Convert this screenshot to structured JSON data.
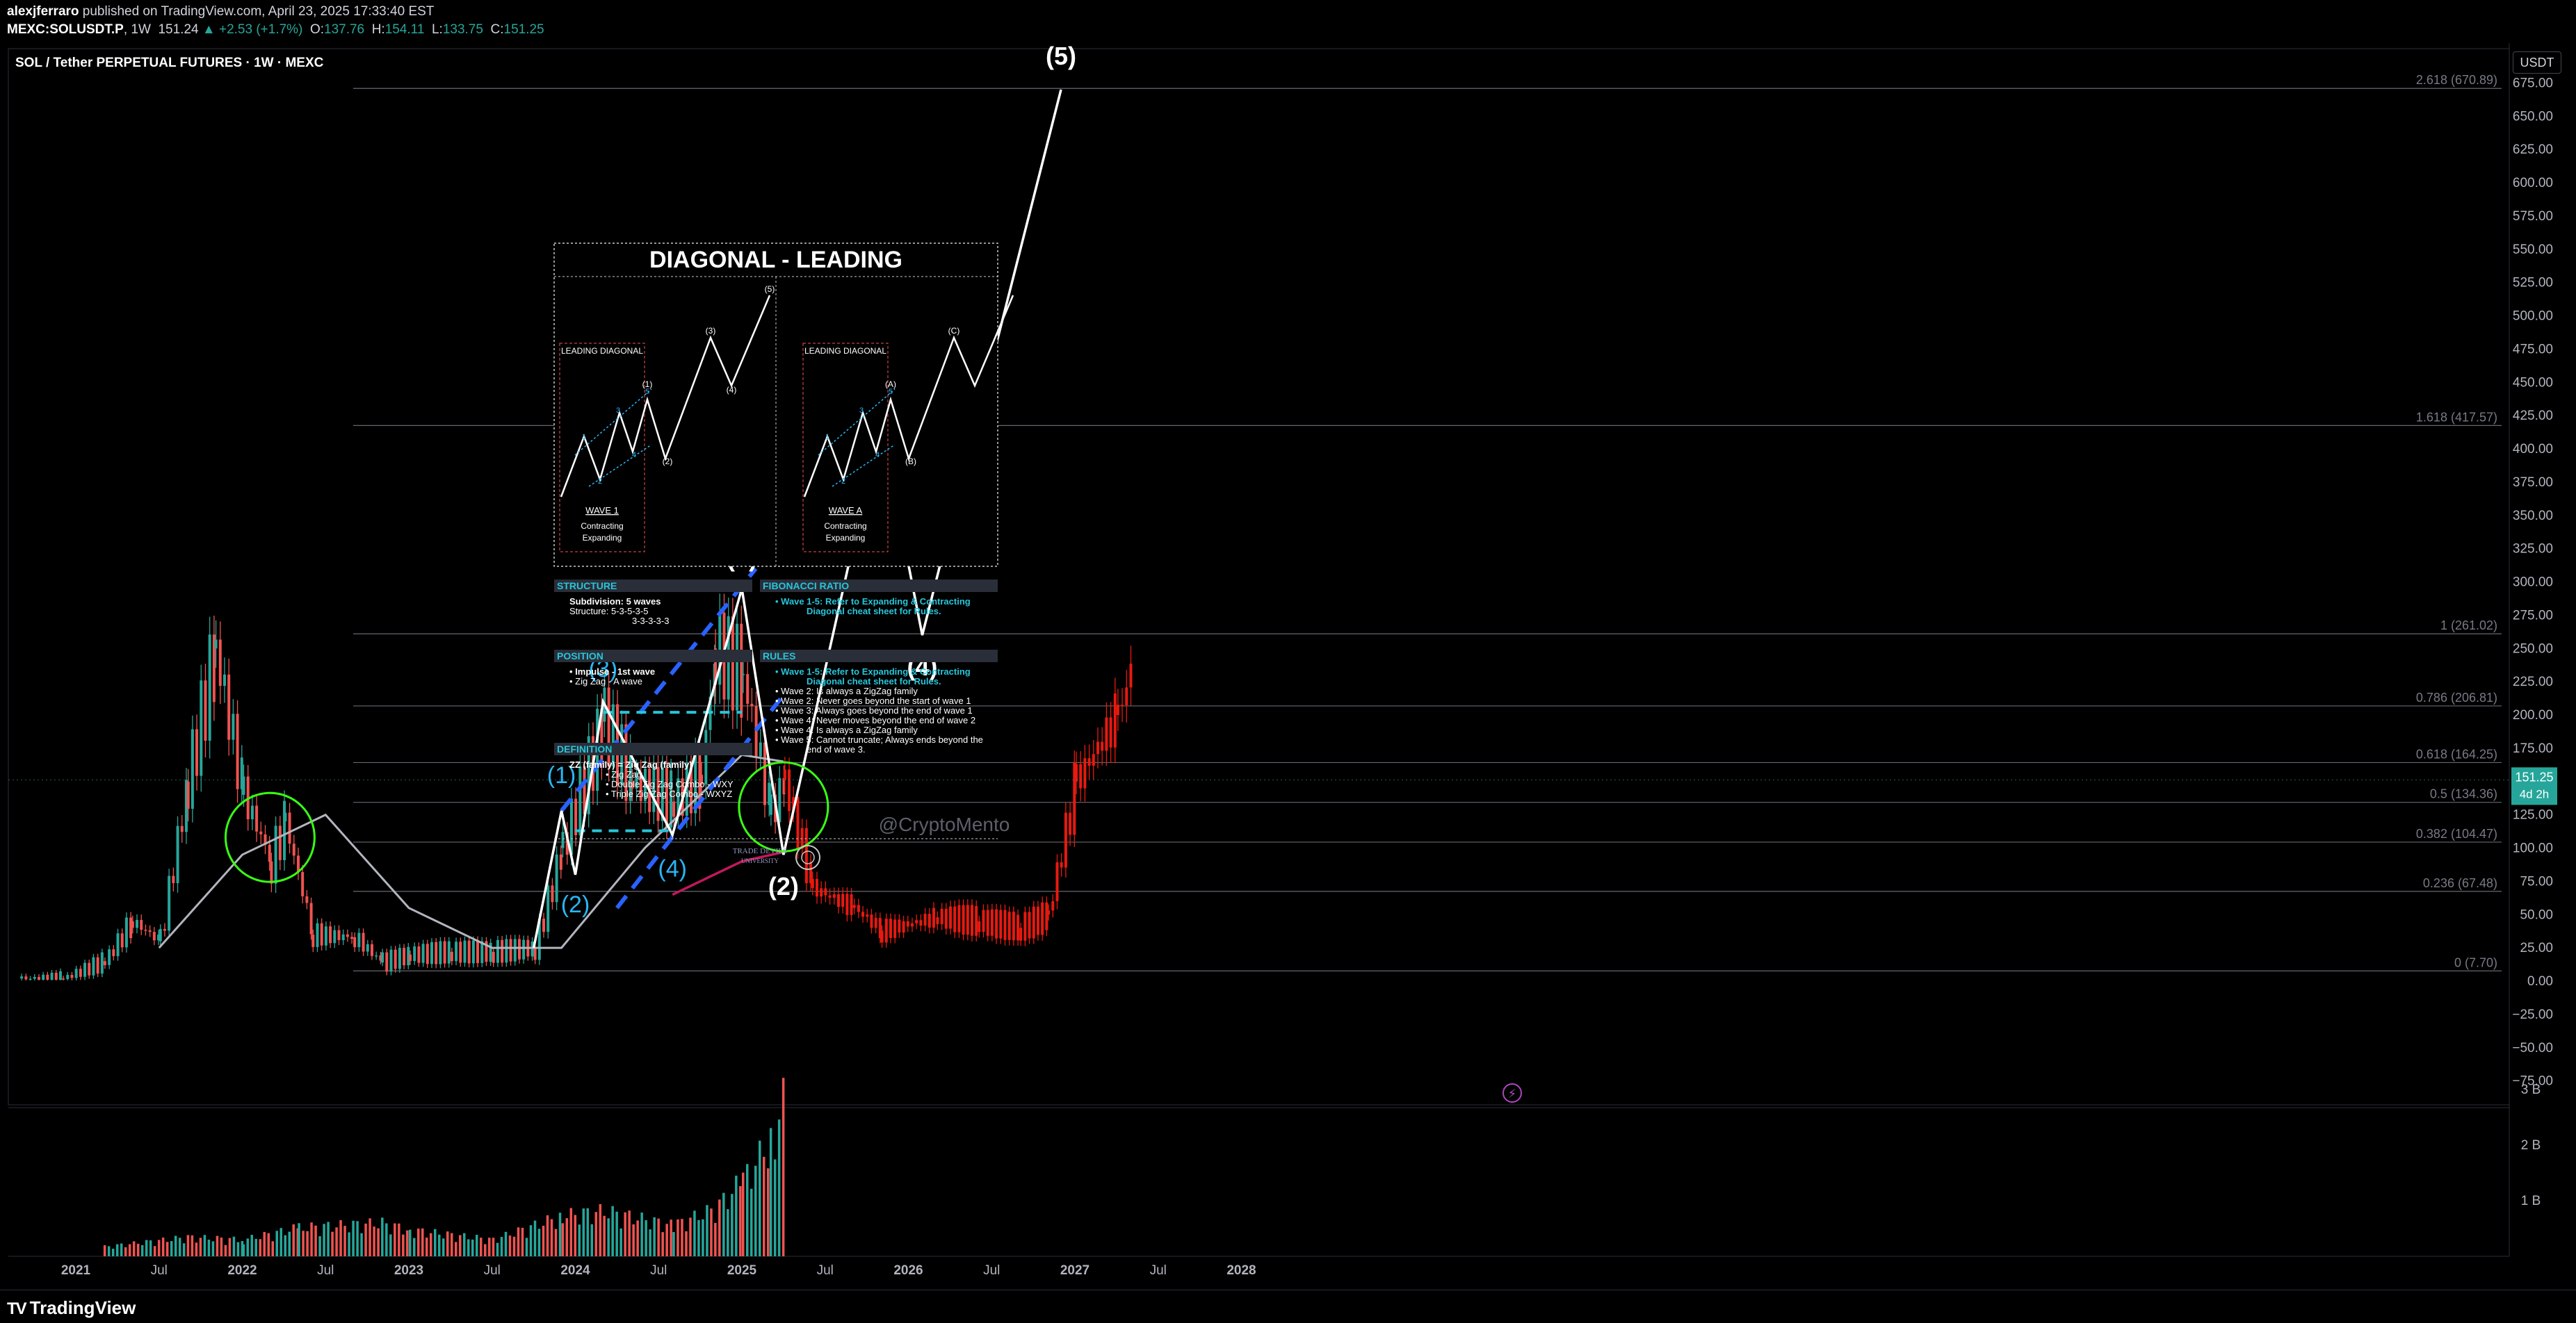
{
  "header": {
    "author": "alexjferraro",
    "published": "published on TradingView.com, April 23, 2025 17:33:40 EST",
    "symbol": "MEXC:SOLUSDT.P",
    "interval": "1W",
    "last": "151.24",
    "change": "▲ +2.53 (+1.7%)",
    "o_label": "O:",
    "o": "137.76",
    "h_label": "H:",
    "h": "154.11",
    "l_label": "L:",
    "l": "133.75",
    "c_label": "C:",
    "c": "151.25"
  },
  "footer": {
    "brand": "TradingView"
  },
  "price_scale": {
    "currency": "USDT"
  },
  "colors": {
    "up": "#26a69a",
    "down": "#ef5350",
    "projection": "#e8190f",
    "wave": "#ffffff",
    "subwave": "#29b6f6",
    "channel": "#2962ff",
    "ma200": "#c2185b",
    "circle": "#39ff14"
  },
  "chart_data": {
    "type": "candlestick",
    "title": "SOL / Tether PERPETUAL FUTURES · 1W · MEXC",
    "y_scale": "linear",
    "ylim": [
      -100,
      700
    ],
    "y_ticks": [
      "675.00",
      "650.00",
      "625.00",
      "600.00",
      "575.00",
      "550.00",
      "525.00",
      "500.00",
      "475.00",
      "450.00",
      "425.00",
      "400.00",
      "375.00",
      "350.00",
      "325.00",
      "300.00",
      "275.00",
      "250.00",
      "225.00",
      "200.00",
      "175.00",
      "150.00",
      "125.00",
      "100.00",
      "75.00",
      "50.00",
      "25.00",
      "0.00",
      "−25.00",
      "−50.00",
      "−75.00"
    ],
    "x_ticks": [
      "2021",
      "Jul",
      "2022",
      "Jul",
      "2023",
      "Jul",
      "2024",
      "Jul",
      "2025",
      "Jul",
      "2026",
      "Jul",
      "2027",
      "Jul",
      "2028"
    ],
    "volume_ticks": [
      "3 B",
      "2 B",
      "1 B"
    ],
    "last_price": {
      "value": "151.25",
      "countdown": "4d 2h",
      "color": "#26a69a"
    },
    "fib_levels": [
      {
        "label": "2.618 (670.89)",
        "value": 670.89
      },
      {
        "label": "1.618 (417.57)",
        "value": 417.57
      },
      {
        "label": "1 (261.02)",
        "value": 261.02
      },
      {
        "label": "0.786 (206.81)",
        "value": 206.81
      },
      {
        "label": "0.618 (164.25)",
        "value": 164.25
      },
      {
        "label": "0.5 (134.36)",
        "value": 134.36
      },
      {
        "label": "0.382 (104.47)",
        "value": 104.47
      },
      {
        "label": "0.236 (67.48)",
        "value": 67.48
      },
      {
        "label": "0 (7.70)",
        "value": 7.7
      }
    ],
    "price_path": [
      {
        "x": "2020-09",
        "y": 2
      },
      {
        "x": "2020-12",
        "y": 2
      },
      {
        "x": "2021-03",
        "y": 15
      },
      {
        "x": "2021-05",
        "y": 45
      },
      {
        "x": "2021-07",
        "y": 30
      },
      {
        "x": "2021-09",
        "y": 150
      },
      {
        "x": "2021-11",
        "y": 250
      },
      {
        "x": "2022-01",
        "y": 140
      },
      {
        "x": "2022-03",
        "y": 90
      },
      {
        "x": "2022-04",
        "y": 120
      },
      {
        "x": "2022-06",
        "y": 35
      },
      {
        "x": "2022-09",
        "y": 33
      },
      {
        "x": "2022-11",
        "y": 14
      },
      {
        "x": "2023-01",
        "y": 20
      },
      {
        "x": "2023-04",
        "y": 22
      },
      {
        "x": "2023-07",
        "y": 22
      },
      {
        "x": "2023-10",
        "y": 25
      },
      {
        "x": "2023-12",
        "y": 100
      },
      {
        "x": "2024-03",
        "y": 195
      },
      {
        "x": "2024-05",
        "y": 150
      },
      {
        "x": "2024-08",
        "y": 135
      },
      {
        "x": "2024-10",
        "y": 155
      },
      {
        "x": "2024-11",
        "y": 250
      },
      {
        "x": "2025-01",
        "y": 230
      },
      {
        "x": "2025-03",
        "y": 125
      },
      {
        "x": "2025-04",
        "y": 151
      }
    ],
    "projection_path": [
      {
        "x": "2025-04",
        "y": 151
      },
      {
        "x": "2025-06",
        "y": 70
      },
      {
        "x": "2025-09",
        "y": 55
      },
      {
        "x": "2025-11",
        "y": 38
      },
      {
        "x": "2026-03",
        "y": 48
      },
      {
        "x": "2026-06",
        "y": 45
      },
      {
        "x": "2026-09",
        "y": 40
      },
      {
        "x": "2026-11",
        "y": 50
      },
      {
        "x": "2027-01",
        "y": 150
      },
      {
        "x": "2027-04",
        "y": 200
      },
      {
        "x": "2027-05",
        "y": 235
      }
    ],
    "ma_gray_path": [
      {
        "x": "2021-07",
        "y": 25
      },
      {
        "x": "2022-01",
        "y": 95
      },
      {
        "x": "2022-07",
        "y": 125
      },
      {
        "x": "2023-01",
        "y": 55
      },
      {
        "x": "2023-07",
        "y": 25
      },
      {
        "x": "2023-12",
        "y": 25
      },
      {
        "x": "2024-06",
        "y": 100
      },
      {
        "x": "2025-01",
        "y": 170
      },
      {
        "x": "2025-04",
        "y": 165
      }
    ],
    "ma_red_path": [
      {
        "x": "2024-08",
        "y": 65
      },
      {
        "x": "2025-01",
        "y": 90
      },
      {
        "x": "2025-04",
        "y": 97
      }
    ],
    "primary_waves": [
      {
        "label": "(1)",
        "x": "2025-01",
        "y": 295
      },
      {
        "label": "(2)",
        "x": "2025-04",
        "y": 95
      },
      {
        "label": "(3)",
        "x": "2025-11",
        "y": 420
      },
      {
        "label": "(4)",
        "x": "2026-02",
        "y": 260
      },
      {
        "label": "(5)",
        "x": "2026-12",
        "y": 670
      }
    ],
    "sub_waves": [
      {
        "label": "(1)",
        "x": "2023-12",
        "y": 128
      },
      {
        "label": "(2)",
        "x": "2024-01",
        "y": 80
      },
      {
        "label": "(3)",
        "x": "2024-03",
        "y": 210
      },
      {
        "label": "(4)",
        "x": "2024-08",
        "y": 110
      },
      {
        "label": "(5)",
        "x": "2025-01",
        "y": 295
      }
    ],
    "channel_lines": [
      {
        "from": {
          "x": "2023-12",
          "y": 128
        },
        "to": {
          "x": "2025-02",
          "y": 310
        }
      },
      {
        "from": {
          "x": "2024-04",
          "y": 55
        },
        "to": {
          "x": "2025-04",
          "y": 215
        }
      }
    ],
    "range_lines": [
      {
        "from": {
          "x": "2024-03",
          "y": 202
        },
        "to": {
          "x": "2025-01",
          "y": 202
        }
      },
      {
        "from": {
          "x": "2024-01",
          "y": 113
        },
        "to": {
          "x": "2024-08",
          "y": 113
        }
      }
    ],
    "circles": [
      {
        "x": "2022-03",
        "y": 108
      },
      {
        "x": "2025-04",
        "y": 131
      }
    ],
    "volume": [
      {
        "x": "2021-03",
        "v": 0.2
      },
      {
        "x": "2021-09",
        "v": 0.4
      },
      {
        "x": "2022-01",
        "v": 0.35
      },
      {
        "x": "2022-05",
        "v": 0.6
      },
      {
        "x": "2022-11",
        "v": 0.7
      },
      {
        "x": "2023-01",
        "v": 0.55
      },
      {
        "x": "2023-07",
        "v": 0.35
      },
      {
        "x": "2023-12",
        "v": 0.85
      },
      {
        "x": "2024-03",
        "v": 0.95
      },
      {
        "x": "2024-08",
        "v": 0.65
      },
      {
        "x": "2024-11",
        "v": 1.0
      },
      {
        "x": "2025-01",
        "v": 1.6
      },
      {
        "x": "2025-03",
        "v": 2.4
      },
      {
        "x": "2025-04",
        "v": 3.3
      }
    ]
  },
  "inset": {
    "title": "DIAGONAL - LEADING",
    "box_label": "LEADING DIAGONAL",
    "left_panel": {
      "wave_label": "WAVE 1",
      "lines": [
        "Contracting",
        "Expanding"
      ],
      "marks": [
        "(1)",
        "(2)",
        "(3)",
        "(4)",
        "(5)",
        "1",
        "2",
        "3",
        "4",
        "5"
      ]
    },
    "right_panel": {
      "wave_label": "WAVE A",
      "lines": [
        "Contracting",
        "Expanding"
      ],
      "marks": [
        "(A)",
        "(B)",
        "(C)",
        "1",
        "2",
        "3",
        "4",
        "5"
      ]
    },
    "sections": {
      "structure": {
        "heading": "STRUCTURE",
        "lines": [
          "Subdivision: 5 waves",
          "Structure:   5-3-5-3-5",
          "3-3-3-3-3"
        ]
      },
      "fibonacci": {
        "heading": "FIBONACCI  RATIO",
        "lines": [
          "• Wave 1-5: Refer to Expanding & Contracting",
          "Diagonal cheat sheet for Rules."
        ]
      },
      "position": {
        "heading": "POSITION",
        "lines": [
          "• Impulse - 1st wave",
          "• Zig Zag - A wave"
        ]
      },
      "rules": {
        "heading": "RULES",
        "lines": [
          "• Wave 1-5: Refer to Expanding & Contracting",
          "Diagonal cheat sheet for Rules.",
          "• Wave 2: Is always a ZigZag family",
          "• Wave 2: Never goes beyond the start of wave 1",
          "• Wave 3: Always goes beyond the end of wave 1",
          "• Wave 4: Never moves beyond the end of wave 2",
          "• Wave 4: Is always a ZigZag family",
          "• Wave 5: Cannot truncate; Always ends beyond the",
          "end of wave 3."
        ]
      },
      "definition": {
        "heading": "DEFINITION",
        "lines": [
          "ZZ (family) =  Zig Zag (family)",
          "• Zig Zag",
          "• Double Zig Zag Combo - WXY",
          "• Triple Zig Zag Combo - WXYZ"
        ]
      }
    },
    "watermark": "@CryptoMento",
    "logo_text": [
      "TRADE DEVILS",
      "UNIVERSITY"
    ]
  }
}
